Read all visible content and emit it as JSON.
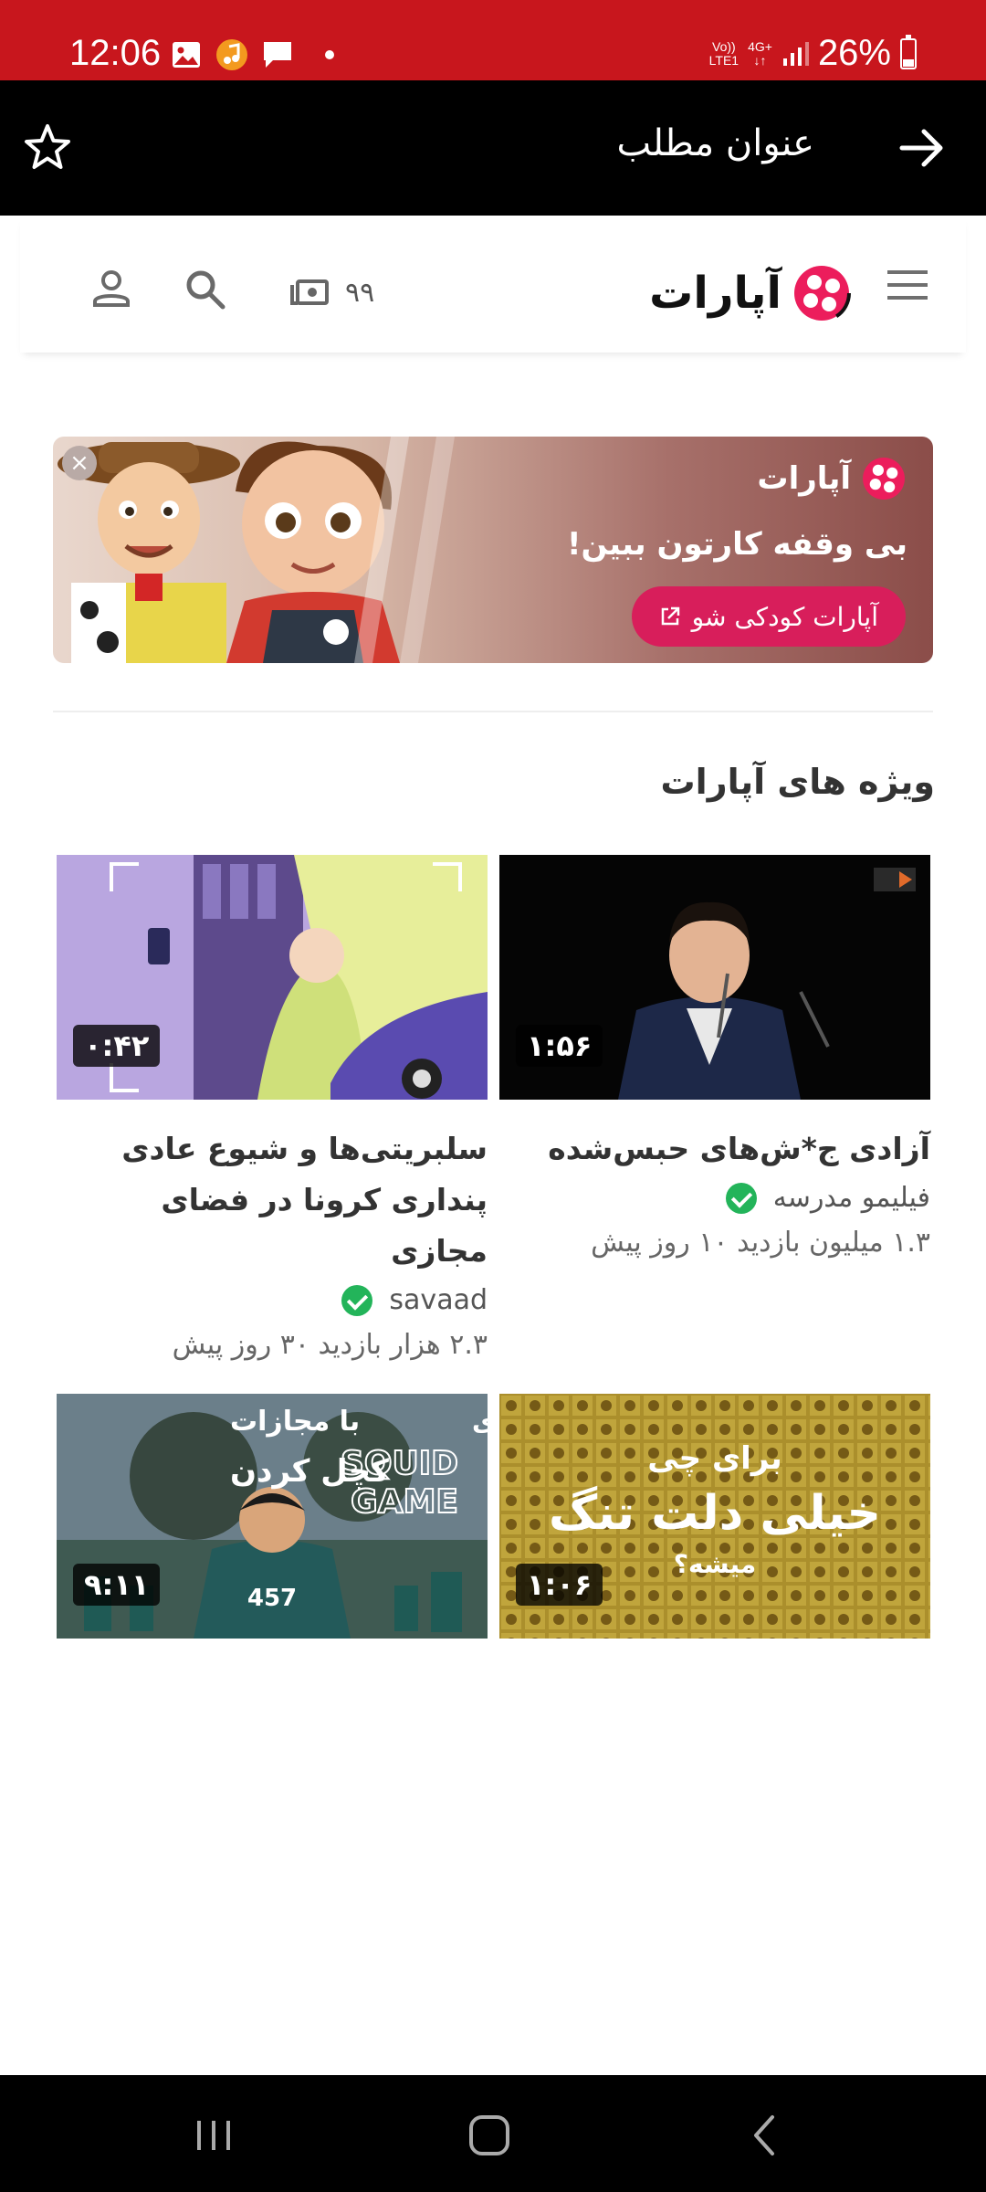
{
  "status_bar": {
    "time": "12:06",
    "icons_left": [
      "gallery-icon",
      "music-icon",
      "message-icon",
      "dot-icon"
    ],
    "network_top": "Vo))",
    "network_bottom": "LTE1",
    "network_type": "4G+",
    "battery": "26%"
  },
  "title_bar": {
    "title": "عنوان مطلب",
    "back_icon": "arrow-right-icon",
    "star_icon": "star-outline-icon"
  },
  "header": {
    "brand": "آپارات",
    "watch_later_count": "۹۹",
    "icons": [
      "menu-icon",
      "logo-icon",
      "watch-later-icon",
      "search-icon",
      "account-icon"
    ]
  },
  "promo": {
    "brand": "آپارات",
    "text": "بی وقفه کارتون ببین!",
    "cta": "آپارات کودکی شو",
    "close": "×"
  },
  "section": {
    "title": "ویژه های آپارات"
  },
  "videos": [
    {
      "title": "آزادی ج*ش‌های حبس‌شده",
      "channel": "فیلیمو مدرسه",
      "meta": "۱.۳ میلیون بازدید  ۱۰ روز پیش",
      "duration": "۱:۵۶"
    },
    {
      "title": "سلبریتی‌ها و شیوع عادی پنداری کرونا در فضای مجازی",
      "channel": "savaad",
      "meta": "۲.۳ هزار بازدید  ۳۰ روز پیش",
      "duration": "۰:۴۲"
    },
    {
      "thumb_text": [
        "برای چی",
        "خیلی دلت تنگ",
        "میشه؟"
      ],
      "duration": "۱:۰۶"
    },
    {
      "thumb_text": [
        "تجربه بازی",
        "با مجازات",
        "SQUID",
        "GAME",
        "کچل کردن",
        "457"
      ],
      "duration": "۹:۱۱"
    }
  ],
  "colors": {
    "status_bar": "#c8161d",
    "brand_pink": "#d81e5b",
    "verified": "#23b45a"
  }
}
